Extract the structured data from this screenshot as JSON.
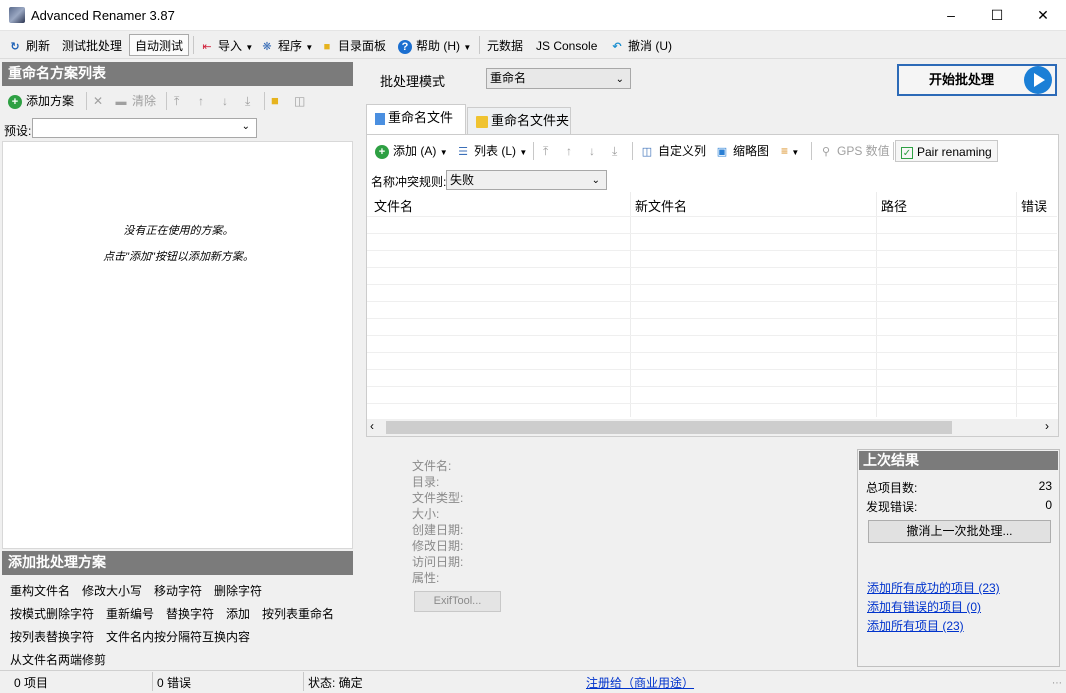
{
  "window": {
    "title": "Advanced Renamer 3.87"
  },
  "toolbar": {
    "refresh": "刷新",
    "test_batch": "测试批处理",
    "auto_test": "自动测试",
    "import": "导入",
    "program": "程序",
    "dir_panel": "目录面板",
    "help": "帮助 (H)",
    "metadata": "元数据",
    "js_console": "JS Console",
    "undo": "撤消 (U)"
  },
  "left": {
    "header": "重命名方案列表",
    "add_method": "添加方案",
    "clear": "清除",
    "preset_label": "预设:",
    "empty_line1": "没有正在使用的方案。",
    "empty_line2": "点击\"添加\"按钮以添加新方案。"
  },
  "add_batch": {
    "header": "添加批处理方案",
    "methods": [
      "重构文件名",
      "修改大小写",
      "移动字符",
      "删除字符",
      "按模式删除字符",
      "重新编号",
      "替换字符",
      "添加",
      "按列表重命名",
      "按列表替换字符",
      "文件名内按分隔符互换内容",
      "从文件名两端修剪"
    ]
  },
  "batch": {
    "mode_label": "批处理模式",
    "mode_value": "重命名",
    "start_button": "开始批处理"
  },
  "tabs": {
    "files": "重命名文件",
    "folders": "重命名文件夹"
  },
  "file_tools": {
    "add": "添加 (A)",
    "list": "列表 (L)",
    "custom_columns": "自定义列",
    "thumbnails": "缩略图",
    "gps": "GPS 数值",
    "pair_renaming": "Pair renaming"
  },
  "conflict": {
    "label": "名称冲突规则:",
    "value": "失败"
  },
  "columns": [
    "文件名",
    "新文件名",
    "路径",
    "错误"
  ],
  "info": {
    "labels": [
      "文件名:",
      "目录:",
      "文件类型:",
      "大小:",
      "创建日期:",
      "修改日期:",
      "访问日期:",
      "属性:"
    ],
    "exif_button": "ExifTool..."
  },
  "results": {
    "header": "上次结果",
    "total_label": "总项目数:",
    "total_value": "23",
    "errors_label": "发现错误:",
    "errors_value": "0",
    "undo_button": "撤消上一次批处理...",
    "link_success": "添加所有成功的项目 (23)",
    "link_errors": "添加有错误的项目 (0)",
    "link_all": "添加所有项目 (23)"
  },
  "status": {
    "items": "0 项目",
    "errors": "0 错误",
    "state": "状态: 确定",
    "register": "注册给（商业用途）"
  }
}
